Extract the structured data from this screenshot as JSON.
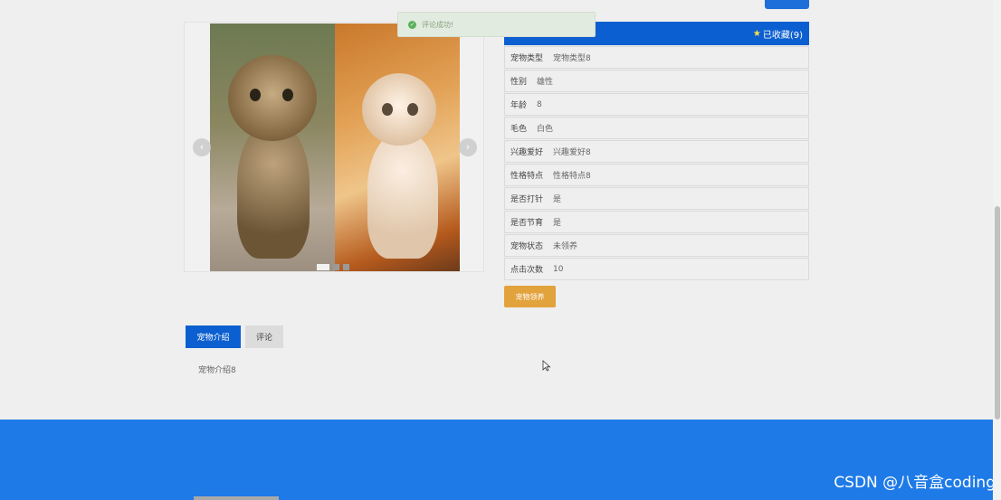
{
  "toast": {
    "message": "评论成功!"
  },
  "details": {
    "header_title": "",
    "favorite_label": "已收藏(9)",
    "rows": [
      {
        "label": "宠物类型",
        "value": "宠物类型8"
      },
      {
        "label": "性别",
        "value": "雄性"
      },
      {
        "label": "年龄",
        "value": "8"
      },
      {
        "label": "毛色",
        "value": "白色"
      },
      {
        "label": "兴趣爱好",
        "value": "兴趣爱好8"
      },
      {
        "label": "性格特点",
        "value": "性格特点8"
      },
      {
        "label": "是否打针",
        "value": "是"
      },
      {
        "label": "是否节育",
        "value": "是"
      },
      {
        "label": "宠物状态",
        "value": "未领养"
      },
      {
        "label": "点击次数",
        "value": "10"
      }
    ],
    "adopt_button": "宠物领养"
  },
  "carousel": {
    "prev_icon": "‹",
    "next_icon": "›",
    "slide_count": 3,
    "active_slide": 1
  },
  "tabs": [
    {
      "label": "宠物介绍",
      "active": true
    },
    {
      "label": "评论",
      "active": false
    }
  ],
  "intro_text": "宠物介绍8",
  "watermark": "CSDN @八音盒coding",
  "colors": {
    "primary": "#0c5fd0",
    "footer": "#1e7ae6",
    "adopt": "#e2a23c",
    "favorite": "#ffe34a"
  }
}
